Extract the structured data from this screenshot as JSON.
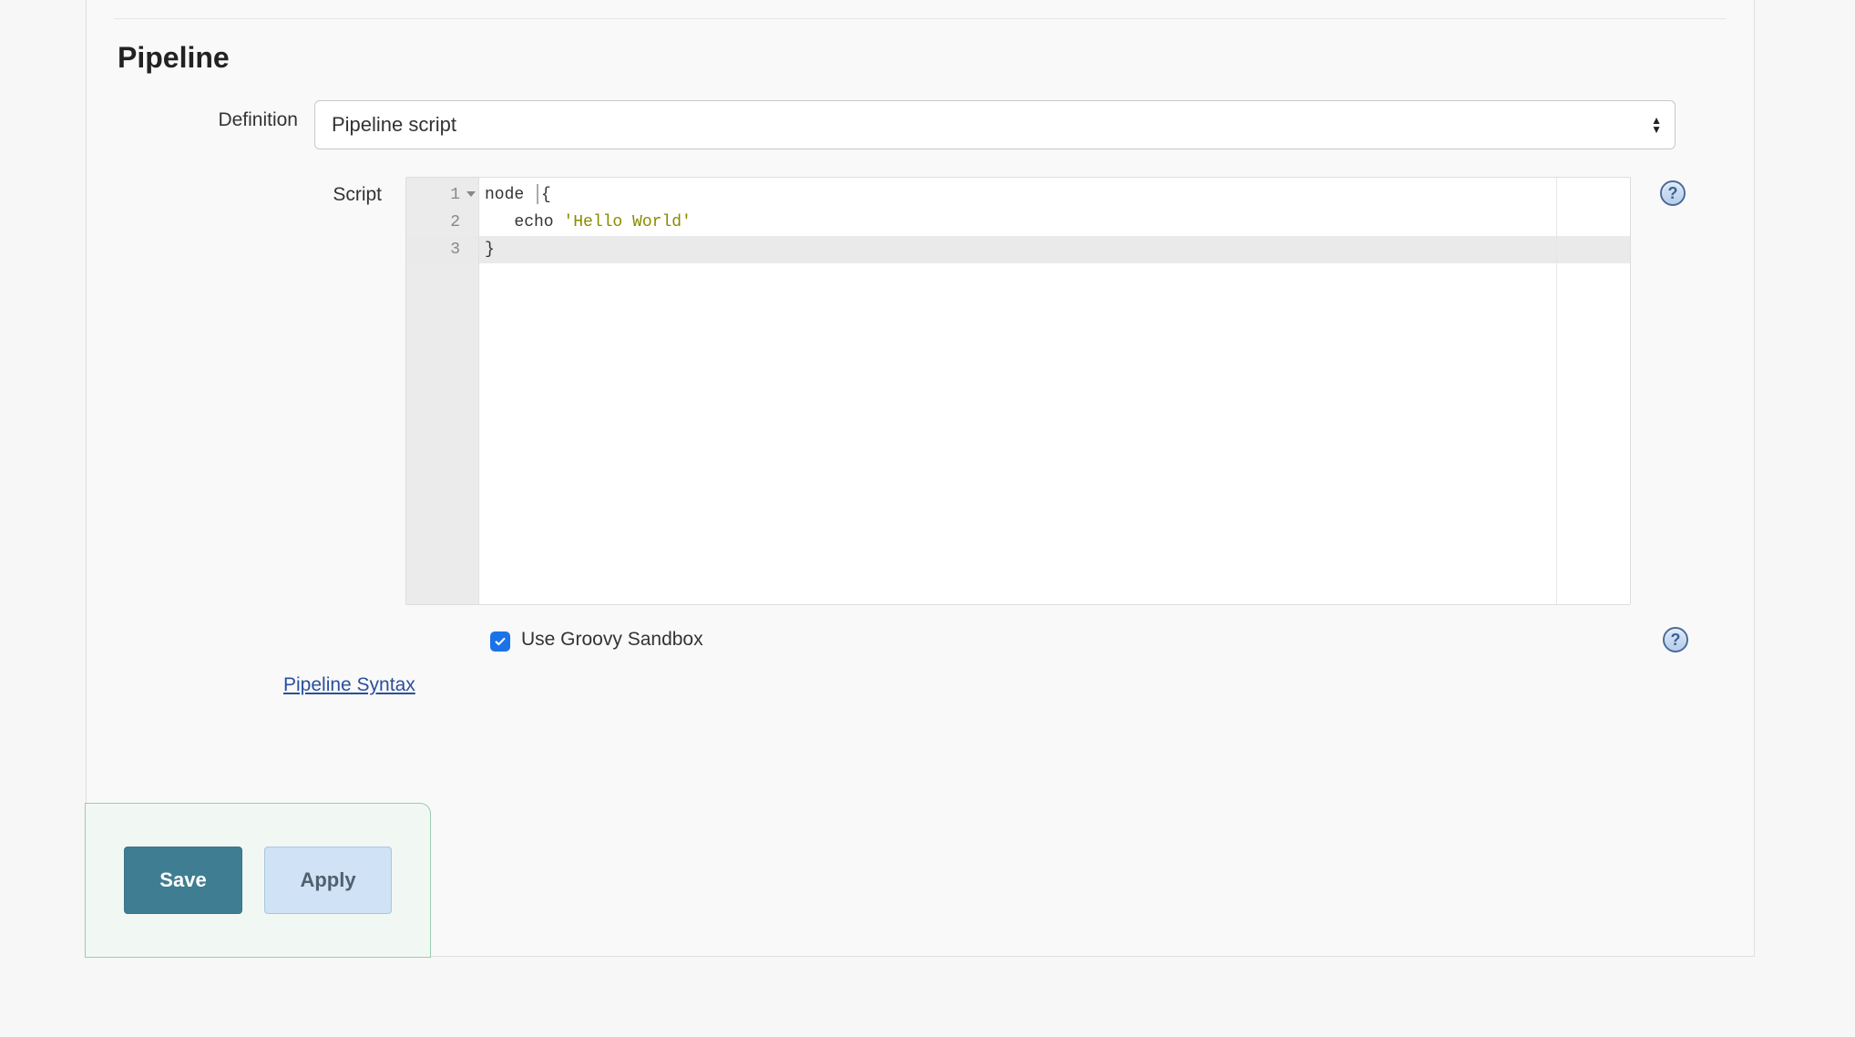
{
  "section": {
    "title": "Pipeline"
  },
  "definition": {
    "label": "Definition",
    "selected": "Pipeline script"
  },
  "script": {
    "label": "Script",
    "lines": [
      {
        "n": "1",
        "text_pre": "node ",
        "text_brace": "{",
        "foldable": true
      },
      {
        "n": "2",
        "indent": "   ",
        "func": "echo ",
        "string": "'Hello World'"
      },
      {
        "n": "3",
        "text_brace": "}",
        "active": true
      }
    ]
  },
  "sandbox": {
    "checked": true,
    "label": "Use Groovy Sandbox"
  },
  "links": {
    "pipeline_syntax": "Pipeline Syntax"
  },
  "buttons": {
    "save": "Save",
    "apply": "Apply"
  },
  "icons": {
    "help": "?"
  }
}
